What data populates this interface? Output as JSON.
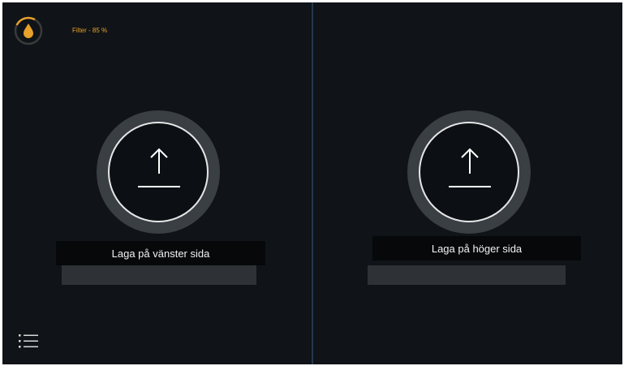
{
  "status": {
    "filter_text": "Filter - 85 %",
    "filter_level_percent": 85,
    "accent_color": "#e8a12a",
    "icon": "water-drop-icon"
  },
  "left": {
    "button_icon": "upload-arrow-icon",
    "label": "Laga på vänster sida"
  },
  "right": {
    "button_icon": "upload-arrow-icon",
    "label": "Laga på höger sida"
  },
  "menu": {
    "icon": "list-menu-icon"
  },
  "colors": {
    "background": "#101418",
    "divider": "#24384c",
    "ring": "#3a3f44",
    "label_bar": "#06080a",
    "status_bar": "#2e3236"
  }
}
